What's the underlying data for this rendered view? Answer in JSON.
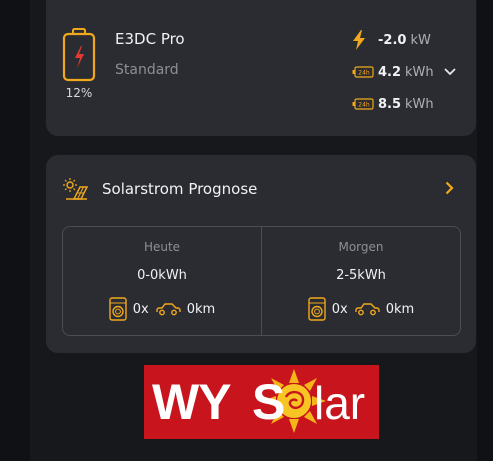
{
  "battery": {
    "percent": "12%",
    "name": "E3DC Pro",
    "mode": "Standard",
    "power": {
      "value": "-2.0",
      "unit": "kW"
    },
    "energy1": {
      "value": "4.2",
      "unit": "kWh",
      "icon_text": "24h"
    },
    "energy2": {
      "value": "8.5",
      "unit": "kWh",
      "icon_text": "24h"
    }
  },
  "solar": {
    "title": "Solarstrom Prognose",
    "today": {
      "label": "Heute",
      "value": "0-0kWh",
      "washes": "0x",
      "distance": "0km"
    },
    "tomorrow": {
      "label": "Morgen",
      "value": "2-5kWh",
      "washes": "0x",
      "distance": "0km"
    }
  },
  "logo": {
    "text": "WYSolar"
  },
  "colors": {
    "accent": "#f2a81d",
    "card": "#2a2c31",
    "battery_bolt": "#e53935",
    "logo_bg": "#c8141c"
  }
}
